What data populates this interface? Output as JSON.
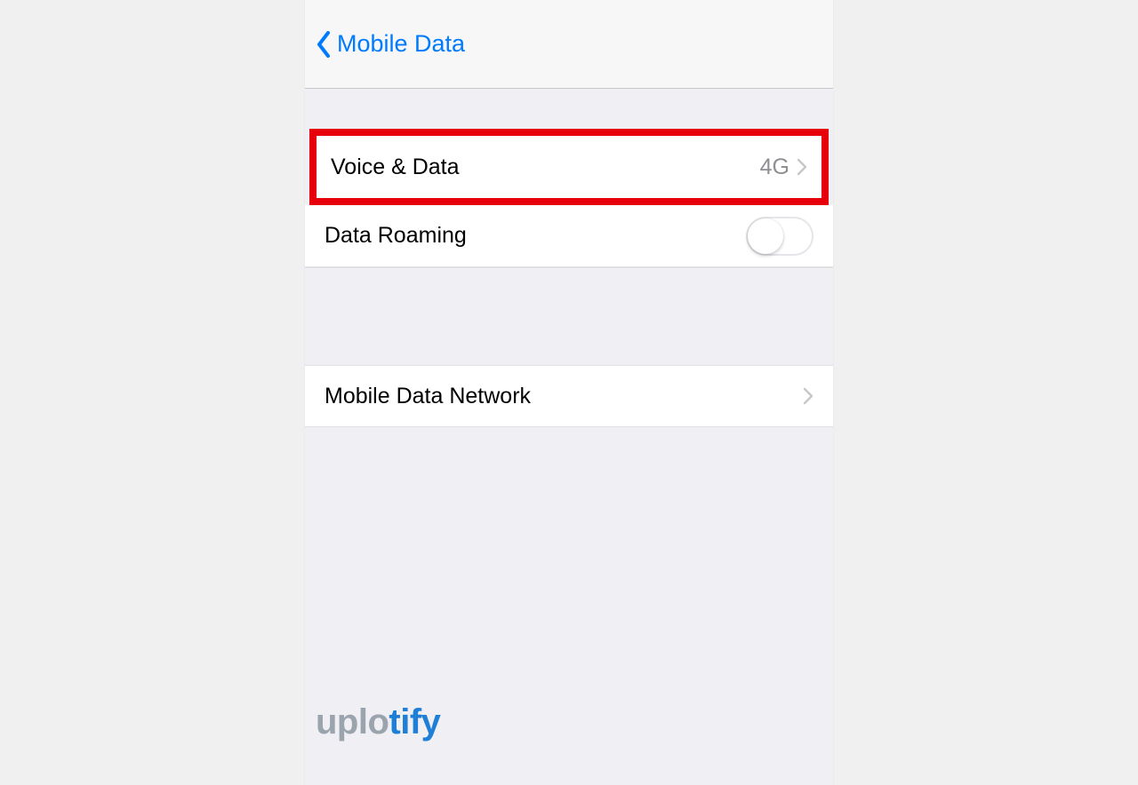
{
  "header": {
    "back_label": "Mobile Data"
  },
  "rows": {
    "voice_data": {
      "label": "Voice & Data",
      "value": "4G"
    },
    "data_roaming": {
      "label": "Data Roaming",
      "toggle_on": false
    },
    "network": {
      "label": "Mobile Data Network"
    }
  },
  "watermark": {
    "part1": "uplo",
    "part2": "tify"
  },
  "highlight_color": "#e7000b"
}
